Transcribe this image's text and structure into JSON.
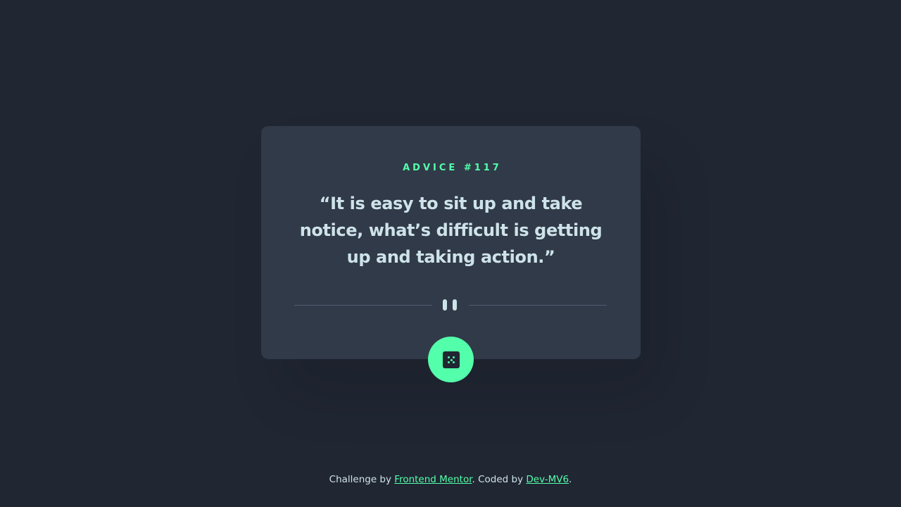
{
  "card": {
    "advice_id": "ADVICE #117",
    "advice_text": "“It is easy to sit up and take notice, what’s difficult is getting up and taking action.”"
  },
  "divider": {
    "icon": "pause-icon"
  },
  "dice_button": {
    "icon": "dice-icon"
  },
  "footer": {
    "prefix": "Challenge by ",
    "link1_label": "Frontend Mentor",
    "middle": ". Coded by ",
    "link2_label": "Dev-MV6",
    "suffix": "."
  },
  "colors": {
    "background": "#202632",
    "card": "#313a48",
    "accent": "#53ffaa",
    "text": "#cee3e9",
    "divider": "#4f5d74"
  }
}
